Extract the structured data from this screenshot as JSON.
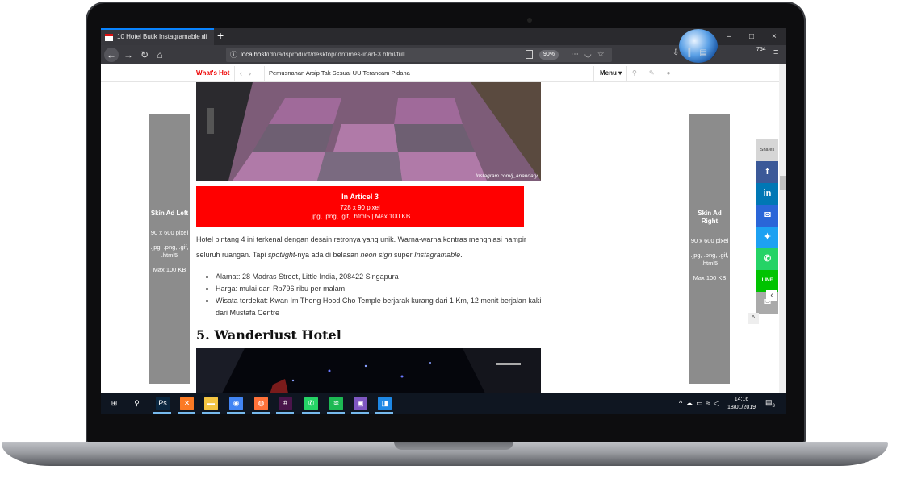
{
  "browser": {
    "tab_title": "10 Hotel Butik Instagramable di",
    "tab_close": "×",
    "new_tab": "+",
    "url_host": "localhost",
    "url_path": "/idn/adsproduct/desktop/idntimes-inart-3.html/full",
    "zoom": "90%",
    "badge_count": "754",
    "win_minimize": "–",
    "win_maximize": "□",
    "win_close": "×",
    "icons": [
      "back-icon",
      "forward-icon",
      "reload-icon",
      "home-icon",
      "info-icon",
      "reader-icon",
      "more-icon",
      "pocket-icon",
      "bookmark-star-icon",
      "download-icon",
      "library-icon",
      "sidebar-icon",
      "menu-icon"
    ]
  },
  "header": {
    "whats_hot": "What's Hot",
    "prev": "‹",
    "next": "›",
    "headline": "Pemusnahan Arsip Tak Sesuai UU Terancam Pidana",
    "menu": "Menu",
    "icons": [
      "search-icon",
      "pencil-icon",
      "user-icon"
    ]
  },
  "skin_ad_left": {
    "title": "Skin Ad Left",
    "size": "90 x 600 pixel",
    "formats": ".jpg, .png, .gif, .html5",
    "max": "Max 100 KB"
  },
  "skin_ad_right": {
    "title": "Skin Ad Right",
    "size": "90 x 600 pixel",
    "formats": ".jpg, .png, .gif, .html5",
    "max": "Max 100 KB"
  },
  "photo_credit": "Instagram.com/j_anandary",
  "in_article": {
    "title": "In Articel 3",
    "size": "728 x 90 pixel",
    "formats": ".jpg, .png, .gif, .html5 | Max 100 KB"
  },
  "article": {
    "para_plain_1": "Hotel bintang 4 ini terkenal dengan desain retronya yang unik. Warna-warna kontras menghiasi hampir seluruh ruangan. Tapi ",
    "para_em_1": "spotlight",
    "para_plain_2": "-nya ada di belasan ",
    "para_em_2": "neon sign",
    "para_plain_3": " super ",
    "para_em_3": "Instagramable",
    "para_plain_4": ".",
    "bullets": [
      "Alamat: 28 Madras Street, Little India, 208422 Singapura",
      "Harga: mulai dari Rp796 ribu per malam",
      "Wisata terdekat: Kwan Im Thong Hood Cho Temple  berjarak kurang dari 1 Km, 12 menit berjalan kaki dari Mustafa Centre"
    ],
    "section_title": "5. Wanderlust Hotel"
  },
  "share": {
    "label": "Shares",
    "buttons": [
      {
        "name": "facebook-icon",
        "glyph": "f",
        "color": "#3b5998"
      },
      {
        "name": "linkedin-icon",
        "glyph": "in",
        "color": "#0077b5"
      },
      {
        "name": "messenger-icon",
        "glyph": "✉",
        "color": "#2a66d8"
      },
      {
        "name": "twitter-icon",
        "glyph": "✦",
        "color": "#1da1f2"
      },
      {
        "name": "whatsapp-icon",
        "glyph": "✆",
        "color": "#25d366"
      },
      {
        "name": "line-icon",
        "glyph": "LINE",
        "color": "#00c300"
      },
      {
        "name": "email-icon",
        "glyph": "✉",
        "color": "#aaaaaa"
      }
    ],
    "collapse": "‹",
    "scroll_top": "^"
  },
  "taskbar": {
    "apps": [
      {
        "name": "start-icon",
        "glyph": "⊞",
        "color": "transparent"
      },
      {
        "name": "search-taskbar-icon",
        "glyph": "⚲",
        "color": "transparent"
      },
      {
        "name": "photoshop-icon",
        "glyph": "Ps",
        "color": "#0a2740"
      },
      {
        "name": "xampp-icon",
        "glyph": "✕",
        "color": "#fb7a24"
      },
      {
        "name": "file-explorer-icon",
        "glyph": "▬",
        "color": "#f4c542"
      },
      {
        "name": "chrome-icon",
        "glyph": "◉",
        "color": "#4285f4"
      },
      {
        "name": "firefox-icon",
        "glyph": "◍",
        "color": "#ff7139"
      },
      {
        "name": "slack-icon",
        "glyph": "#",
        "color": "#4a154b"
      },
      {
        "name": "whatsapp-taskbar-icon",
        "glyph": "✆",
        "color": "#25d366"
      },
      {
        "name": "spotify-icon",
        "glyph": "≋",
        "color": "#1db954"
      },
      {
        "name": "notepad-icon",
        "glyph": "▣",
        "color": "#7e57c2"
      },
      {
        "name": "app-icon",
        "glyph": "◨",
        "color": "#1e88e5"
      }
    ],
    "time": "14:16",
    "date": "18/01/2019",
    "notifications": "3"
  }
}
